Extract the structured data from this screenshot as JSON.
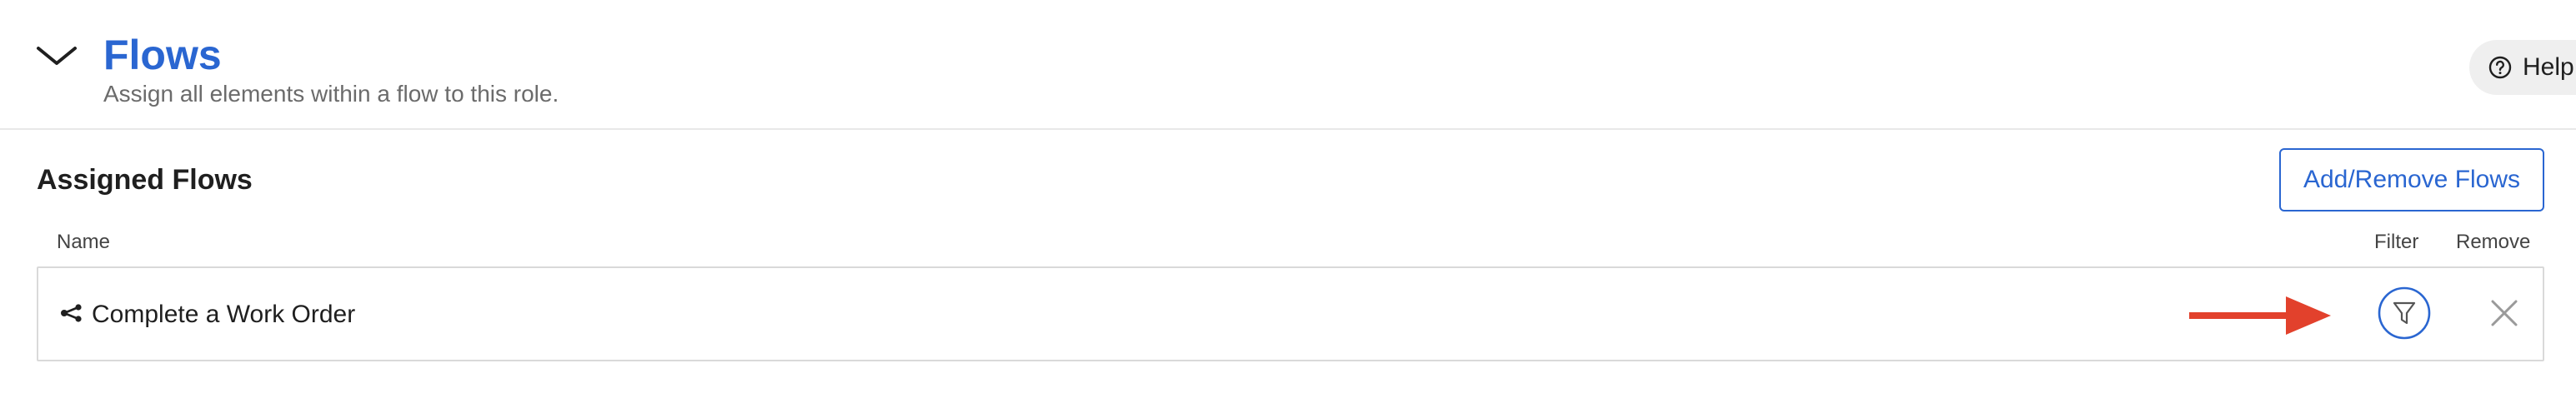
{
  "header": {
    "title": "Flows",
    "subtitle": "Assign all elements within a flow to this role.",
    "help_label": "Help"
  },
  "assigned": {
    "title": "Assigned Flows",
    "add_button_label": "Add/Remove Flows",
    "columns": {
      "name": "Name",
      "filter": "Filter",
      "remove": "Remove"
    },
    "rows": [
      {
        "name": "Complete a Work Order"
      }
    ]
  },
  "colors": {
    "accent": "#2a66d1",
    "annotation_arrow": "#e2412c",
    "border": "#d9d9d9"
  },
  "icons": {
    "collapse": "chevron-down-icon",
    "help": "question-circle-icon",
    "flow": "flow-branch-icon",
    "filter": "filter-funnel-icon",
    "remove": "close-icon",
    "annotation": "red-arrow-right-icon"
  }
}
